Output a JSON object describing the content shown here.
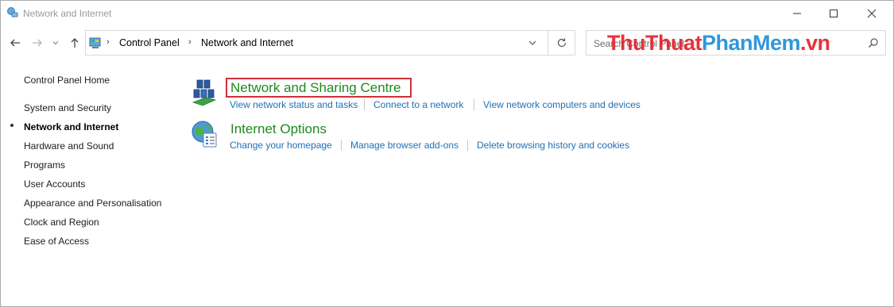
{
  "window": {
    "title": "Network and Internet"
  },
  "addressbar": {
    "crumbs": [
      "Control Panel",
      "Network and Internet"
    ]
  },
  "search": {
    "placeholder": "Search Control Panel"
  },
  "watermark": {
    "part1": "ThuThuat",
    "part2": "PhanMem",
    "part3": ".vn"
  },
  "sidebar": {
    "home": "Control Panel Home",
    "items": [
      {
        "label": "System and Security",
        "active": false
      },
      {
        "label": "Network and Internet",
        "active": true
      },
      {
        "label": "Hardware and Sound",
        "active": false
      },
      {
        "label": "Programs",
        "active": false
      },
      {
        "label": "User Accounts",
        "active": false
      },
      {
        "label": "Appearance and Personalisation",
        "active": false
      },
      {
        "label": "Clock and Region",
        "active": false
      },
      {
        "label": "Ease of Access",
        "active": false
      }
    ]
  },
  "categories": [
    {
      "title": "Network and Sharing Centre",
      "tasks": [
        "View network status and tasks",
        "Connect to a network",
        "View network computers and devices"
      ]
    },
    {
      "title": "Internet Options",
      "tasks": [
        "Change your homepage",
        "Manage browser add-ons",
        "Delete browsing history and cookies"
      ]
    }
  ],
  "colors": {
    "link": "#1f6fb5",
    "category_title": "#1e8a1e",
    "highlight": "#d0303a"
  }
}
